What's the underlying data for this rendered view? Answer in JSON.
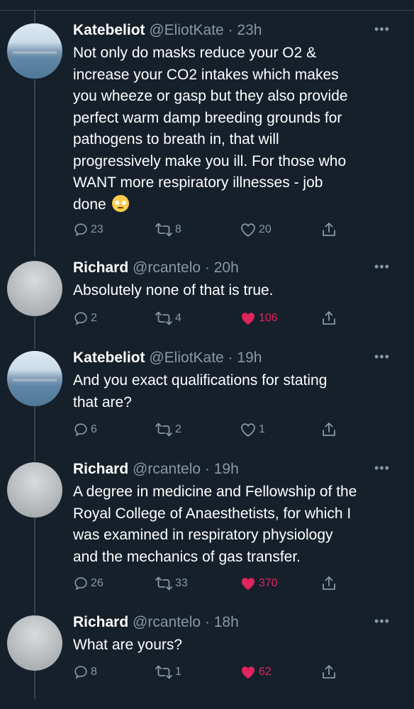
{
  "tweets": [
    {
      "name": "Katebeliot",
      "handle": "@EliotKate",
      "time": "23h",
      "avatar": "sea-landscape",
      "lines": [
        "Not only do masks reduce your O2 &",
        "increase your CO2 intakes which makes",
        "you wheeze or gasp but they also provide",
        "perfect warm damp breeding grounds for",
        "pathogens to breath in, that will",
        "progressively make you ill. For those who",
        "WANT more respiratory illnesses - job",
        "done"
      ],
      "emoji": "face-with-rolling-eyes",
      "replies": "23",
      "retweets": "8",
      "likes": "20",
      "liked": false
    },
    {
      "name": "Richard",
      "handle": "@rcantelo",
      "time": "20h",
      "avatar": "man-with-hat",
      "lines": [
        "Absolutely none of that is true."
      ],
      "replies": "2",
      "retweets": "4",
      "likes": "106",
      "liked": true
    },
    {
      "name": "Katebeliot",
      "handle": "@EliotKate",
      "time": "19h",
      "avatar": "sea-landscape",
      "lines": [
        "And you exact qualifications for stating",
        "that are?"
      ],
      "replies": "6",
      "retweets": "2",
      "likes": "1",
      "liked": false
    },
    {
      "name": "Richard",
      "handle": "@rcantelo",
      "time": "19h",
      "avatar": "man-with-hat",
      "lines": [
        "A degree in medicine and Fellowship of the",
        "Royal College of Anaesthetists, for which I",
        "was examined in respiratory physiology",
        "and the mechanics of gas transfer."
      ],
      "replies": "26",
      "retweets": "33",
      "likes": "370",
      "liked": true
    },
    {
      "name": "Richard",
      "handle": "@rcantelo",
      "time": "18h",
      "avatar": "man-with-hat",
      "lines": [
        "What are yours?"
      ],
      "replies": "8",
      "retweets": "1",
      "likes": "62",
      "liked": true
    }
  ],
  "colors": {
    "background": "#15202b",
    "muted": "#8899a6",
    "like": "#e0245e",
    "divider": "#38444d"
  }
}
